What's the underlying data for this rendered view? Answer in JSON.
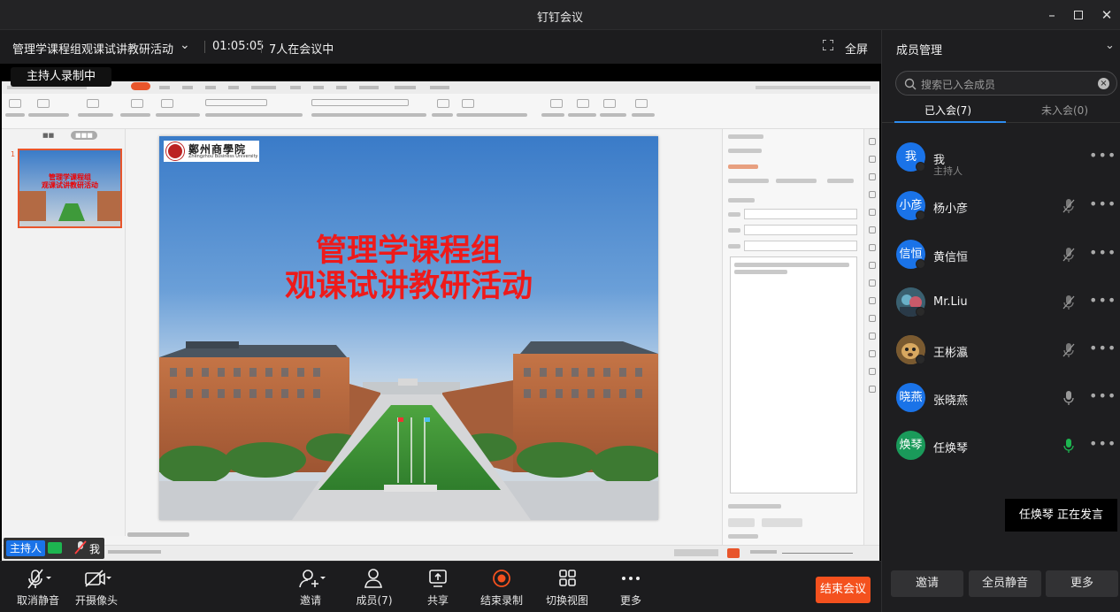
{
  "window": {
    "title": "钉钉会议"
  },
  "meeting": {
    "title": "管理学课程组观课试讲教研活动",
    "duration": "01:05:05",
    "participants_status": "7人在会议中",
    "fullscreen_label": "全屏",
    "recording_banner": "主持人录制中"
  },
  "shared_screen": {
    "slide_title_line1": "管理学课程组",
    "slide_title_line2": "观课试讲教研活动",
    "logo_name": "鄭州商學院",
    "logo_subtitle": "Zhengzhou Business University"
  },
  "self_tile": {
    "host_label": "主持人",
    "name": "我"
  },
  "toolbar": {
    "unmute": "取消静音",
    "camera_on": "开摄像头",
    "invite": "邀请",
    "members": "成员(7)",
    "share": "共享",
    "stop_recording": "结束录制",
    "switch_view": "切换视图",
    "more": "更多",
    "end_meeting": "结束会议"
  },
  "members_panel": {
    "title": "成员管理",
    "search_placeholder": "搜索已入会成员",
    "tab_joined": "已入会(7)",
    "tab_not_joined": "未入会(0)",
    "members": [
      {
        "avatar": "我",
        "name": "我",
        "role": "主持人",
        "mic": "none"
      },
      {
        "avatar": "小彦",
        "name": "杨小彦",
        "role": "",
        "mic": "muted"
      },
      {
        "avatar": "信恒",
        "name": "黄信恒",
        "role": "",
        "mic": "muted"
      },
      {
        "avatar": "",
        "name": "Mr.Liu",
        "role": "",
        "mic": "muted"
      },
      {
        "avatar": "",
        "name": "王彬瀛",
        "role": "",
        "mic": "muted"
      },
      {
        "avatar": "晓燕",
        "name": "张晓燕",
        "role": "",
        "mic": "on"
      },
      {
        "avatar": "焕琴",
        "name": "任焕琴",
        "role": "",
        "mic": "speaking"
      }
    ],
    "speaking_toast": "任焕琴  正在发言",
    "invite_button": "邀请",
    "mute_all_button": "全员静音",
    "more_button": "更多"
  },
  "colors": {
    "accent": "#1a73e8",
    "end": "#f4511e",
    "record": "#f4511e",
    "speaking": "#1db550"
  }
}
